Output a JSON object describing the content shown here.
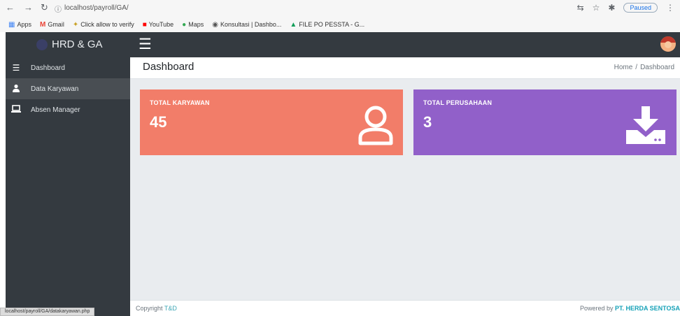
{
  "browser": {
    "address": "localhost/payroll/GA/",
    "paused_label": "Paused",
    "bookmarks": [
      {
        "label": "Apps",
        "icon": "apps-grid-icon"
      },
      {
        "label": "Gmail",
        "icon": "gmail-icon"
      },
      {
        "label": "Click allow to verify",
        "icon": "bookmark-icon"
      },
      {
        "label": "YouTube",
        "icon": "youtube-icon"
      },
      {
        "label": "Maps",
        "icon": "maps-icon"
      },
      {
        "label": "Konsultasi | Dashbo...",
        "icon": "globe-icon"
      },
      {
        "label": "FILE PO PESSTA - G...",
        "icon": "drive-icon"
      }
    ],
    "status_url": "localhost/payroll/GA/datakaryawan.php"
  },
  "app": {
    "brand": "HRD & GA"
  },
  "sidebar": {
    "items": [
      {
        "label": "Dashboard",
        "icon": "bars-icon"
      },
      {
        "label": "Data Karyawan",
        "icon": "user-icon"
      },
      {
        "label": "Absen Manager",
        "icon": "laptop-icon"
      }
    ]
  },
  "header": {
    "title": "Dashboard",
    "breadcrumb": [
      "Home",
      "Dashboard"
    ]
  },
  "cards": [
    {
      "label": "TOTAL KARYAWAN",
      "value": "45",
      "color": "#f27d69",
      "icon": "user-outline-icon"
    },
    {
      "label": "TOTAL PERUSAHAAN",
      "value": "3",
      "color": "#9160c9",
      "icon": "download-icon"
    }
  ],
  "footer": {
    "left_prefix": "Copyright",
    "left_brand": "T&D",
    "right_prefix": "Powered by",
    "right_company": "PT. HERDA SENTOSA"
  }
}
